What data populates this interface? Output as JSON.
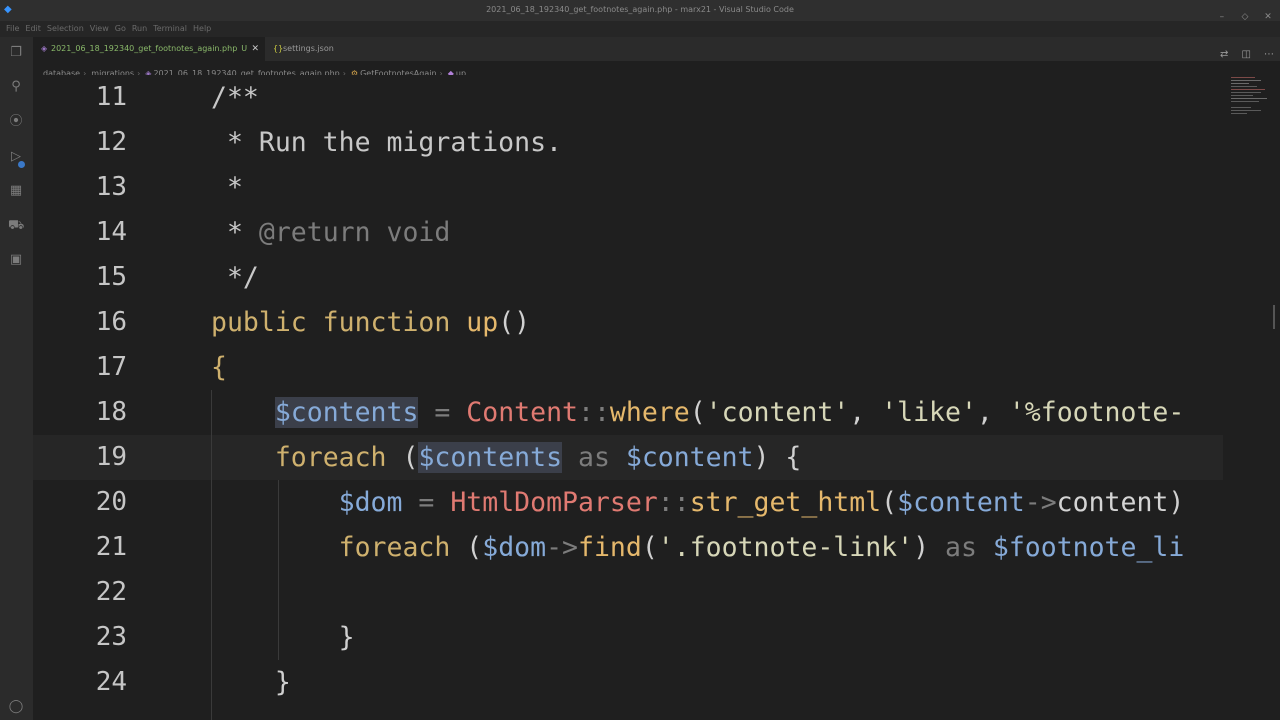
{
  "window": {
    "title": "2021_06_18_192340_get_footnotes_again.php - marx21 - Visual Studio Code"
  },
  "menu": [
    "File",
    "Edit",
    "Selection",
    "View",
    "Go",
    "Run",
    "Terminal",
    "Help"
  ],
  "tabs": [
    {
      "label": "2021_06_18_192340_get_footnotes_again.php",
      "status": "U",
      "active": true
    },
    {
      "label": "settings.json",
      "active": false
    }
  ],
  "breadcrumb": [
    "database",
    "migrations",
    "2021_06_18_192340_get_footnotes_again.php",
    "GetFootnotesAgain",
    "up"
  ],
  "editor": {
    "line_numbers": [
      "11",
      "12",
      "13",
      "14",
      "15",
      "16",
      "17",
      "18",
      "19",
      "20",
      "21",
      "22",
      "23",
      "24"
    ],
    "lines": [
      [
        {
          "t": "/**",
          "c": "c-doc"
        }
      ],
      [
        {
          "t": " * Run the migrations.",
          "c": "c-doc"
        }
      ],
      [
        {
          "t": " *",
          "c": "c-doc"
        }
      ],
      [
        {
          "t": " * ",
          "c": "c-doc"
        },
        {
          "t": "@return void",
          "c": "c-com"
        }
      ],
      [
        {
          "t": " */",
          "c": "c-doc"
        }
      ],
      [
        {
          "t": "public function ",
          "c": "c-kw"
        },
        {
          "t": "up",
          "c": "c-fn"
        },
        {
          "t": "()",
          "c": "c-pn"
        }
      ],
      [
        {
          "t": "{",
          "c": "c-kw"
        }
      ],
      [
        {
          "t": "    ",
          "c": "c-pn"
        },
        {
          "t": "$contents",
          "c": "c-var hl"
        },
        {
          "t": " = ",
          "c": "c-op"
        },
        {
          "t": "Content",
          "c": "c-cls"
        },
        {
          "t": "::",
          "c": "c-op"
        },
        {
          "t": "where",
          "c": "c-fn"
        },
        {
          "t": "(",
          "c": "c-pn"
        },
        {
          "t": "'content'",
          "c": "c-str"
        },
        {
          "t": ", ",
          "c": "c-pn"
        },
        {
          "t": "'like'",
          "c": "c-str"
        },
        {
          "t": ", ",
          "c": "c-pn"
        },
        {
          "t": "'%footnote-",
          "c": "c-str"
        }
      ],
      [
        {
          "t": "    ",
          "c": "c-pn"
        },
        {
          "t": "foreach ",
          "c": "c-kw"
        },
        {
          "t": "(",
          "c": "c-pn"
        },
        {
          "t": "$contents",
          "c": "c-var hl"
        },
        {
          "t": " as ",
          "c": "c-as"
        },
        {
          "t": "$content",
          "c": "c-var"
        },
        {
          "t": ") {",
          "c": "c-pn"
        }
      ],
      [
        {
          "t": "        ",
          "c": "c-pn"
        },
        {
          "t": "$dom",
          "c": "c-var"
        },
        {
          "t": " = ",
          "c": "c-op"
        },
        {
          "t": "HtmlDomParser",
          "c": "c-cls"
        },
        {
          "t": "::",
          "c": "c-op"
        },
        {
          "t": "str_get_html",
          "c": "c-fn"
        },
        {
          "t": "(",
          "c": "c-pn"
        },
        {
          "t": "$content",
          "c": "c-var"
        },
        {
          "t": "->",
          "c": "c-op"
        },
        {
          "t": "content",
          "c": "c-prop"
        },
        {
          "t": ")",
          "c": "c-pn"
        }
      ],
      [
        {
          "t": "        ",
          "c": "c-pn"
        },
        {
          "t": "foreach ",
          "c": "c-kw"
        },
        {
          "t": "(",
          "c": "c-pn"
        },
        {
          "t": "$dom",
          "c": "c-var"
        },
        {
          "t": "->",
          "c": "c-op"
        },
        {
          "t": "find",
          "c": "c-fn"
        },
        {
          "t": "(",
          "c": "c-pn"
        },
        {
          "t": "'.footnote-link'",
          "c": "c-str"
        },
        {
          "t": ") ",
          "c": "c-pn"
        },
        {
          "t": "as ",
          "c": "c-as"
        },
        {
          "t": "$footnote_li",
          "c": "c-var"
        }
      ],
      [],
      [
        {
          "t": "        ",
          "c": "c-pn"
        },
        {
          "t": "}",
          "c": "c-pn"
        }
      ],
      [
        {
          "t": "    ",
          "c": "c-pn"
        },
        {
          "t": "}",
          "c": "c-pn"
        }
      ]
    ],
    "current_line": "19"
  }
}
